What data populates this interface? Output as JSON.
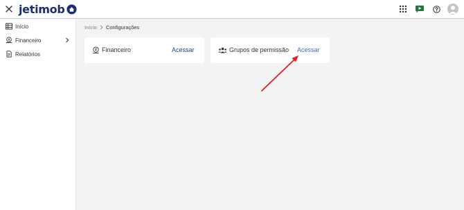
{
  "app": {
    "logo_text": "jetimob"
  },
  "sidebar": {
    "items": [
      {
        "label": "Início",
        "icon": "table-icon"
      },
      {
        "label": "Financeiro",
        "icon": "money-icon",
        "has_children": true
      },
      {
        "label": "Relatórios",
        "icon": "document-icon"
      }
    ]
  },
  "breadcrumb": {
    "home": "Início",
    "current": "Configurações"
  },
  "cards": [
    {
      "title": "Financeiro",
      "link": "Acessar",
      "icon": "money-icon"
    },
    {
      "title": "Grupos de permissão",
      "link": "Acessar",
      "icon": "users-group-icon"
    }
  ],
  "annotation": {
    "color": "#e02020",
    "target": "Grupos de permissão — Acessar"
  },
  "colors": {
    "brand": "#1d2d73",
    "link": "#1d3e8f",
    "link_highlight": "#3d6fc7",
    "background": "#f3f3f3",
    "annotation_red": "#e02020"
  }
}
